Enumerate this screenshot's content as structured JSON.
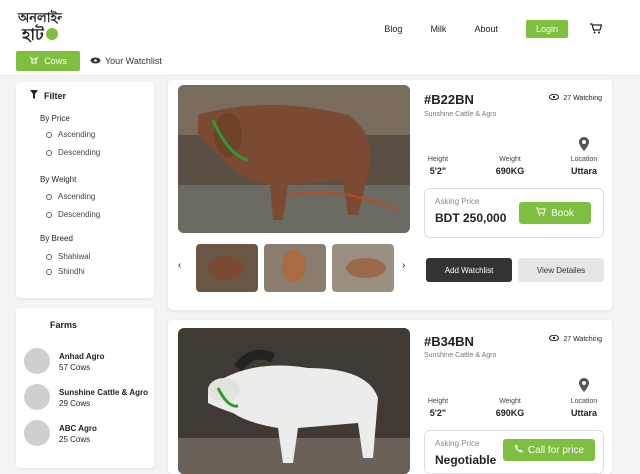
{
  "header": {
    "logo_text": "অনলাইন হাট",
    "nav": [
      "Blog",
      "Milk",
      "About"
    ],
    "login_label": "Login"
  },
  "subnav": {
    "cows_label": "Cows",
    "watchlist_label": "Your Watchlist"
  },
  "filter": {
    "title": "Filter",
    "groups": [
      {
        "label": "By Price",
        "options": [
          "Ascending",
          "Descending"
        ]
      },
      {
        "label": "By Weight",
        "options": [
          "Ascending",
          "Descending"
        ]
      },
      {
        "label": "By Breed",
        "options": [
          "Shahiwal",
          "Shindhi"
        ]
      }
    ]
  },
  "farms": {
    "title": "Farms",
    "items": [
      {
        "name": "Anhad Agro",
        "count": "57 Cows"
      },
      {
        "name": "Sunshine Cattle & Agro",
        "count": "29 Cows"
      },
      {
        "name": "ABC Agro",
        "count": "25 Cows"
      }
    ]
  },
  "listings": [
    {
      "id": "#B22BN",
      "farm": "Sunshine Cattle & Agro",
      "watching": "27 Watching",
      "height_label": "Height",
      "height": "5'2\"",
      "weight_label": "Weight",
      "weight": "690KG",
      "location_label": "Location",
      "location": "Uttara",
      "price_label": "Asking Price",
      "price": "BDT 250,000",
      "action_label": "Book",
      "watch_btn": "Add Watchlist",
      "details_btn": "View Detailes"
    },
    {
      "id": "#B34BN",
      "farm": "Sunshine Cattle & Agro",
      "watching": "27 Watching",
      "height_label": "Height",
      "height": "5'2\"",
      "weight_label": "Weight",
      "weight": "690KG",
      "location_label": "Location",
      "location": "Uttara",
      "price_label": "Asking Price",
      "price": "Negotiable",
      "action_label": "Call for price"
    }
  ],
  "colors": {
    "accent": "#7fbf3f",
    "dark_button": "#333333"
  }
}
